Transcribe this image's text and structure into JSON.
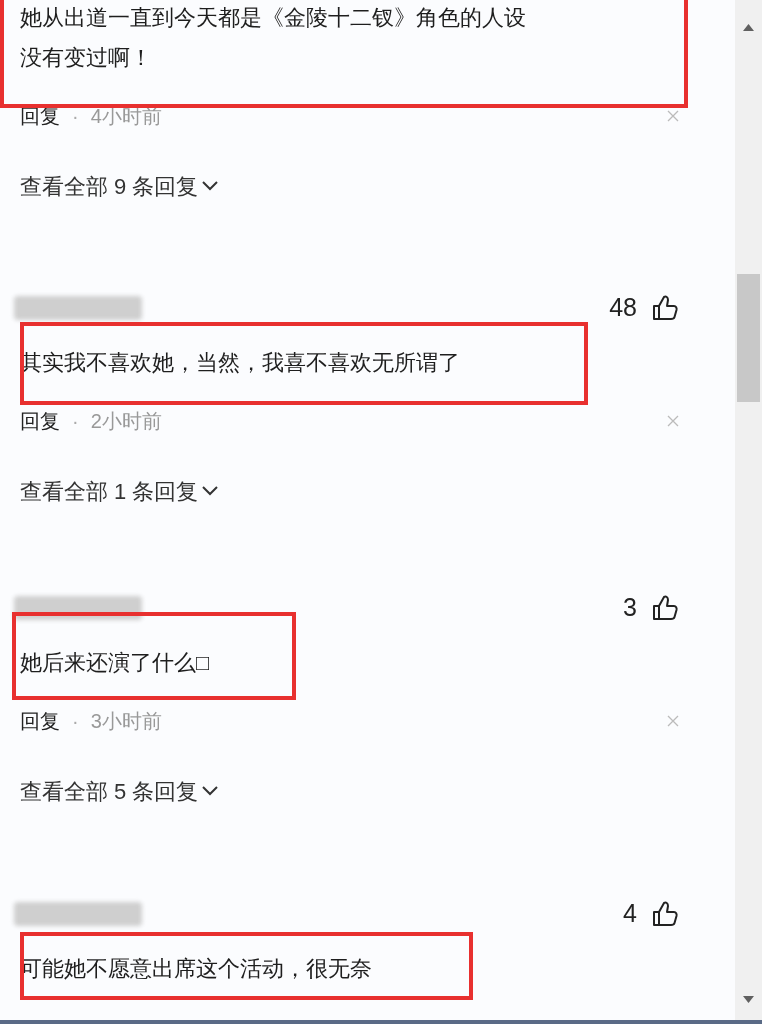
{
  "comments": [
    {
      "text": [
        "她从出道一直到今天都是《金陵十二钗》角色的人设",
        "没有变过啊！"
      ],
      "reply_label": "回复",
      "separator": "·",
      "time": "4小时前",
      "view_replies": "查看全部 9 条回复",
      "highlighted": true
    },
    {
      "username_blurred": true,
      "likes": "48",
      "text": [
        "其实我不喜欢她，当然，我喜不喜欢无所谓了"
      ],
      "reply_label": "回复",
      "separator": "·",
      "time": "2小时前",
      "view_replies": "查看全部 1 条回复",
      "highlighted": true
    },
    {
      "username_blurred": true,
      "likes": "3",
      "text": [
        "她后来还演了什么□"
      ],
      "reply_label": "回复",
      "separator": "·",
      "time": "3小时前",
      "view_replies": "查看全部 5 条回复",
      "highlighted": true
    },
    {
      "username_blurred": true,
      "likes": "4",
      "text": [
        "可能她不愿意出席这个活动，很无奈"
      ],
      "highlighted": true
    }
  ]
}
